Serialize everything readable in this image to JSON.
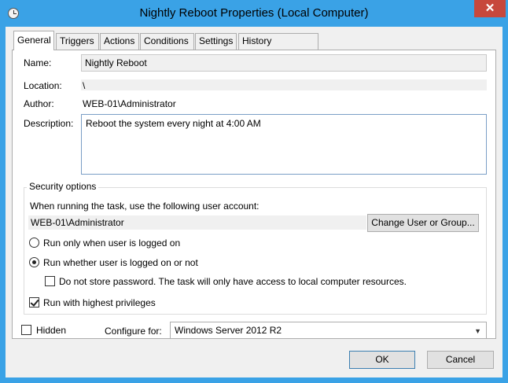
{
  "window": {
    "title": "Nightly Reboot Properties (Local Computer)",
    "close_glyph": "✕"
  },
  "tabs": [
    {
      "label": "General",
      "active": true
    },
    {
      "label": "Triggers"
    },
    {
      "label": "Actions"
    },
    {
      "label": "Conditions"
    },
    {
      "label": "Settings"
    },
    {
      "label": "History (disabled)"
    }
  ],
  "general": {
    "name_label": "Name:",
    "name_value": "Nightly Reboot",
    "location_label": "Location:",
    "location_value": "\\",
    "author_label": "Author:",
    "author_value": "WEB-01\\Administrator",
    "description_label": "Description:",
    "description_value": "Reboot the system every night at 4:00 AM"
  },
  "security": {
    "group_title": "Security options",
    "account_prompt": "When running the task, use the following user account:",
    "account_value": "WEB-01\\Administrator",
    "change_button": "Change User or Group...",
    "radio_logged_on": "Run only when user is logged on",
    "radio_whether": "Run whether user is logged on or not",
    "no_store_password": "Do not store password.  The task will only have access to local computer resources.",
    "highest_privileges": "Run with highest privileges",
    "radio_selected": "whether",
    "highest_checked": true,
    "no_store_checked": false
  },
  "bottom": {
    "hidden_label": "Hidden",
    "hidden_checked": false,
    "configure_label": "Configure for:",
    "configure_value": "Windows Server 2012 R2",
    "ok_button": "OK",
    "cancel_button": "Cancel"
  },
  "colors": {
    "title_bar": "#3aa2e6",
    "close_button": "#c7483c",
    "description_border": "#7a9ec6"
  }
}
